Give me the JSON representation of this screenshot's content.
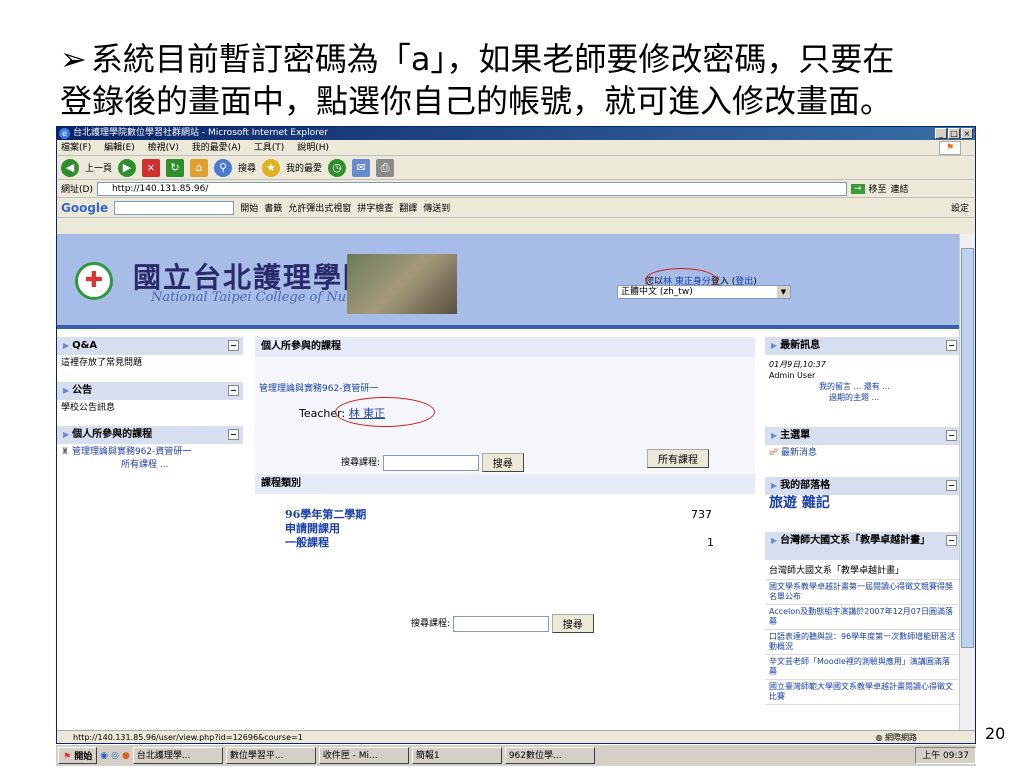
{
  "slide": {
    "bullet": "➢",
    "title_line1": "系統目前暫訂密碼為「a」，如果老師要修改密碼，只要在",
    "title_line2": "登錄後的畫面中，點選你自己的帳號，就可進入修改畫面。",
    "page_number": "20"
  },
  "browser": {
    "window_title": "台北護理學院數位學習社群網站 - Microsoft Internet Explorer",
    "menu": [
      "檔案(F)",
      "編輯(E)",
      "檢視(V)",
      "我的最愛(A)",
      "工具(T)",
      "說明(H)"
    ],
    "toolbar": {
      "back": "上一頁",
      "search": "搜尋",
      "favorites": "我的最愛"
    },
    "address_label": "網址(D)",
    "address": "http://140.131.85.96/",
    "go": "移至",
    "links": "連結",
    "google": {
      "logo": "Google",
      "start": "開始",
      "bookmarks": "書籤",
      "popup": "允許彈出式視窗",
      "spell": "拼字檢查",
      "translate": "翻譯",
      "send": "傳送到",
      "settings": "設定"
    },
    "status_url": "http://140.131.85.96/user/view.php?id=12696&course=1",
    "status_zone": "網際網路"
  },
  "site": {
    "name_zh": "國立台北護理學院",
    "name_en": "National Taipei College of Nursing",
    "login_prefix": "您以",
    "login_user": "林 東正身分",
    "login_suffix": "登入 (",
    "logout": "登出",
    "login_close": ")",
    "language": "正體中文 (zh_tw)"
  },
  "left": {
    "qa_title": "Q&A",
    "qa_body": "這裡存放了常見問題",
    "news_title": "公告",
    "news_body": "學校公告訊息",
    "courses_title": "個人所參與的課程",
    "course1": "管理理論與實務962-資管研一",
    "all_courses": "所有課程 ..."
  },
  "center": {
    "my_courses_title": "個人所參與的課程",
    "course_link": "管理理論與實務962-資管研一",
    "teacher_label": "Teacher:",
    "teacher_name": "林 東正",
    "search_label": "搜尋課程:",
    "search_button": "搜尋",
    "all_courses_button": "所有課程",
    "categories_title": "課程類別",
    "categories": [
      {
        "name": "96學年第二學期",
        "count": "737"
      },
      {
        "name": "申請開課用",
        "count": ""
      },
      {
        "name": "一般課程",
        "count": "1"
      }
    ],
    "search2_label": "搜尋課程:",
    "search2_button": "搜尋"
  },
  "right": {
    "latest_title": "最新訊息",
    "latest_date": "01月9日,10:37",
    "latest_user": "Admin User",
    "latest_msg": "我的留言 ... 還有 ...",
    "latest_more": "過期的主題 ...",
    "menu_title": "主選單",
    "menu_item": "最新消息",
    "blog_title": "我的部落格",
    "blog_logo": "旅遊 雜記",
    "proj_title": "台灣師大國文系「教學卓越計畫」",
    "proj_items": [
      "台灣師大國文系「教學卓越計畫」",
      "國文學系教學卓越計畫第一屆閱讀心得徵文競賽得獎名單公布",
      "Accelon及動態組字演講於2007年12月07日圓滿落幕",
      "口語表達的聽與說：96學年度第一次數師增能研習活動概況",
      "辛文芸老師「Moodle裡的測驗與應用」演講圓滿落幕",
      "國立臺灣師範大學國文系教學卓越計畫閱讀心得徵文比賽"
    ]
  },
  "taskbar": {
    "start": "開始",
    "tasks": [
      "台北護理學...",
      "數位學習平...",
      "收件匣 - Mi...",
      "簡報1",
      "962數位學..."
    ],
    "clock": "上午 09:37"
  }
}
